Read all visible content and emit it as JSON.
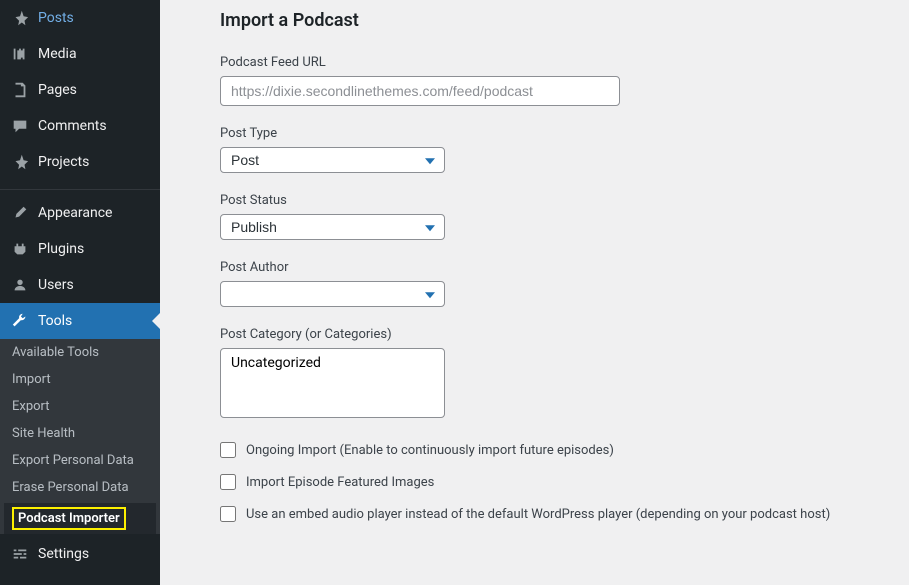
{
  "sidebar": {
    "items": [
      {
        "label": "Posts",
        "icon": "pin"
      },
      {
        "label": "Media",
        "icon": "media"
      },
      {
        "label": "Pages",
        "icon": "page"
      },
      {
        "label": "Comments",
        "icon": "comment"
      },
      {
        "label": "Projects",
        "icon": "pin"
      }
    ],
    "items2": [
      {
        "label": "Appearance",
        "icon": "brush"
      },
      {
        "label": "Plugins",
        "icon": "plug"
      },
      {
        "label": "Users",
        "icon": "user"
      },
      {
        "label": "Tools",
        "icon": "wrench",
        "active": true
      },
      {
        "label": "Settings",
        "icon": "sliders"
      }
    ],
    "submenu": [
      "Available Tools",
      "Import",
      "Export",
      "Site Health",
      "Export Personal Data",
      "Erase Personal Data",
      "Podcast Importer"
    ]
  },
  "page": {
    "title": "Import a Podcast",
    "form": {
      "feedUrl": {
        "label": "Podcast Feed URL",
        "placeholder": "https://dixie.secondlinethemes.com/feed/podcast",
        "value": ""
      },
      "postType": {
        "label": "Post Type",
        "value": "Post"
      },
      "postStatus": {
        "label": "Post Status",
        "value": "Publish"
      },
      "postAuthor": {
        "label": "Post Author",
        "value": ""
      },
      "postCategory": {
        "label": "Post Category (or Categories)",
        "value": "Uncategorized"
      },
      "ongoingImport": {
        "label": "Ongoing Import (Enable to continuously import future episodes)"
      },
      "importImages": {
        "label": "Import Episode Featured Images"
      },
      "embedPlayer": {
        "label": "Use an embed audio player instead of the default WordPress player (depending on your podcast host)"
      }
    }
  }
}
